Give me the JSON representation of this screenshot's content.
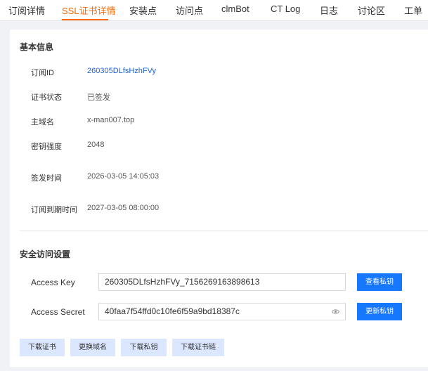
{
  "tabs": [
    {
      "label": "订阅详情"
    },
    {
      "label": "SSL证书详情"
    },
    {
      "label": "安装点"
    },
    {
      "label": "访问点"
    },
    {
      "label": "clmBot"
    },
    {
      "label": "CT Log"
    },
    {
      "label": "日志"
    },
    {
      "label": "讨论区"
    },
    {
      "label": "工单"
    }
  ],
  "active_tab": "SSL证书详情",
  "colors": {
    "accent": "#ff6a00",
    "link": "#1a62d6",
    "primary_button": "#1677ff",
    "light_button": "#dbe7ff"
  },
  "basic_info": {
    "title": "基本信息",
    "rows": [
      {
        "label": "订阅ID",
        "value": "260305DLfsHzhFVy"
      },
      {
        "label": "证书状态",
        "value": "已签发"
      },
      {
        "label": "主域名",
        "value": "x-man007.top"
      },
      {
        "label": "密钥强度",
        "value": "2048"
      },
      {
        "label": "签发时间",
        "value": "2026-03-05 14:05:03"
      },
      {
        "label": "订阅到期时间",
        "value": "2027-03-05 08:00:00"
      }
    ]
  },
  "security": {
    "title": "安全访问设置",
    "access_key": {
      "label": "Access Key",
      "value": "260305DLfsHzhFVy_7156269163898613",
      "button": "查看私钥"
    },
    "access_secret": {
      "label": "Access Secret",
      "value": "40faa7f54ffd0c10fe6f59a9bd18387c",
      "button": "更新私钥",
      "icon": "eye-icon"
    }
  },
  "actions": [
    {
      "label": "下载证书"
    },
    {
      "label": "更换域名"
    },
    {
      "label": "下载私钥"
    },
    {
      "label": "下载证书链"
    }
  ]
}
